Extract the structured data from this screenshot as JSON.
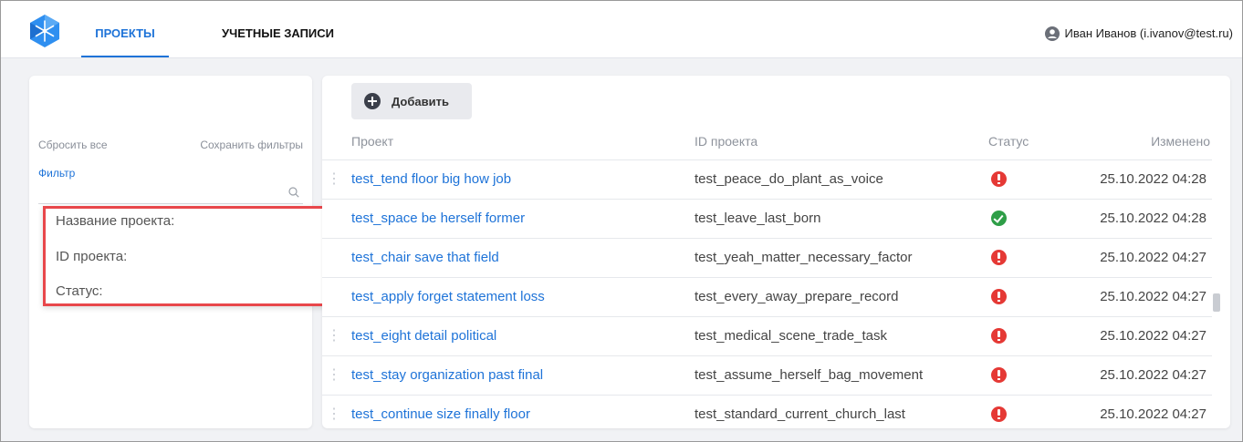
{
  "header": {
    "tabs": [
      {
        "label": "ПРОЕКТЫ",
        "active": true
      },
      {
        "label": "УЧЕТНЫЕ ЗАПИСИ",
        "active": false
      }
    ],
    "user": "Иван Иванов (i.ivanov@test.ru)",
    "accent_color": "#1e73d8"
  },
  "filters": {
    "reset_label": "Сбросить все",
    "save_label": "Сохранить фильтры",
    "filter_label": "Фильтр",
    "input_value": "",
    "dropdown": [
      "Название проекта:",
      "ID проекта:",
      "Статус:"
    ]
  },
  "table": {
    "add_label": "Добавить",
    "columns": [
      "Проект",
      "ID проекта",
      "Статус",
      "Изменено"
    ],
    "rows": [
      {
        "name": "test_tend floor big how job",
        "id": "test_peace_do_plant_as_voice",
        "status": "error",
        "modified": "25.10.2022 04:28"
      },
      {
        "name": "test_space be herself former",
        "id": "test_leave_last_born",
        "status": "ok",
        "modified": "25.10.2022 04:28"
      },
      {
        "name": "test_chair save that field",
        "id": "test_yeah_matter_necessary_factor",
        "status": "error",
        "modified": "25.10.2022 04:27"
      },
      {
        "name": "test_apply forget statement loss",
        "id": "test_every_away_prepare_record",
        "status": "error",
        "modified": "25.10.2022 04:27"
      },
      {
        "name": "test_eight detail political",
        "id": "test_medical_scene_trade_task",
        "status": "error",
        "modified": "25.10.2022 04:27"
      },
      {
        "name": "test_stay organization past final",
        "id": "test_assume_herself_bag_movement",
        "status": "error",
        "modified": "25.10.2022 04:27"
      },
      {
        "name": "test_continue size finally floor",
        "id": "test_standard_current_church_last",
        "status": "error",
        "modified": "25.10.2022 04:27"
      }
    ]
  }
}
